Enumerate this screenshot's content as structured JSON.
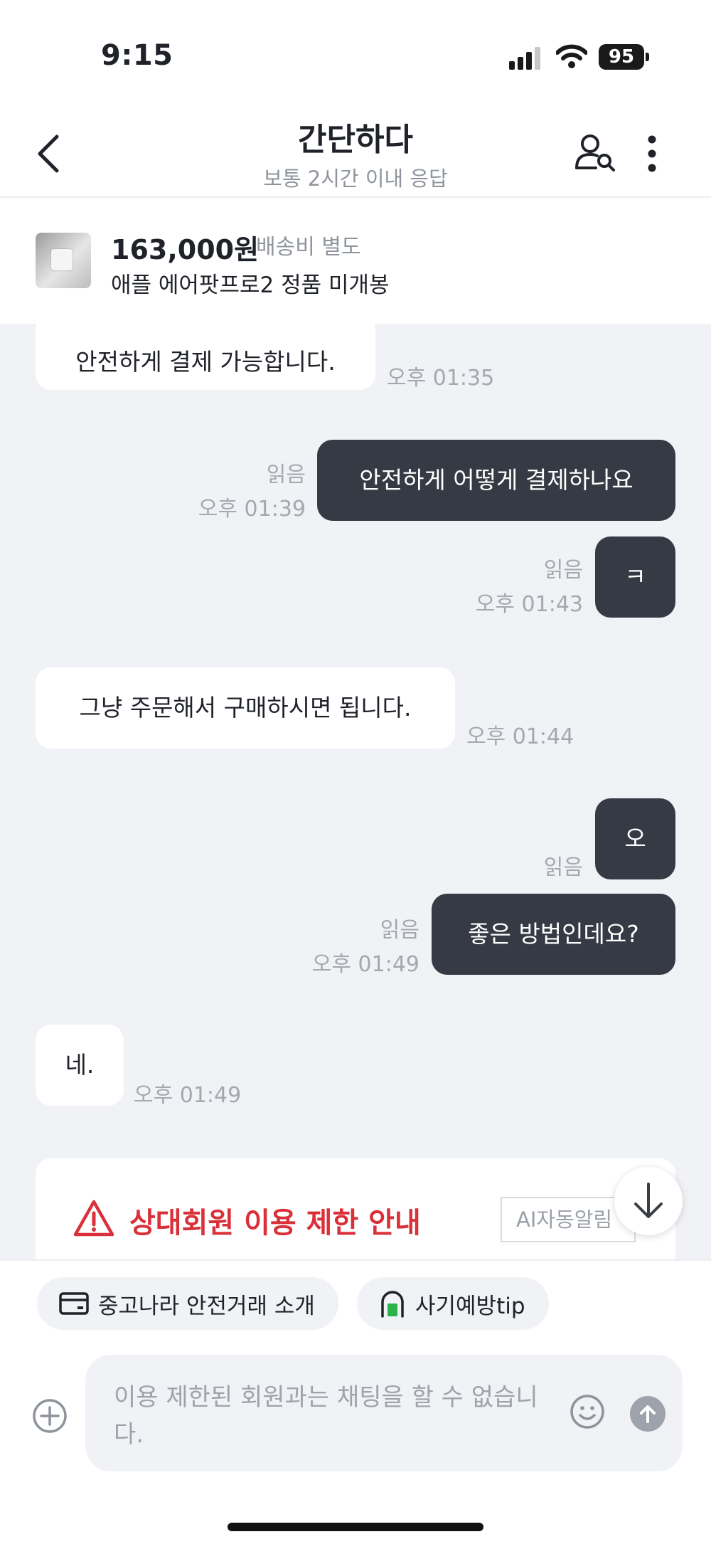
{
  "status_bar": {
    "time": "9:15",
    "battery": "95"
  },
  "header": {
    "title": "간단하다",
    "subtitle": "보통 2시간 이내 응답"
  },
  "product": {
    "price": "163,000원",
    "shipping": "배송비 별도",
    "name": "애플 에어팟프로2 정품 미개봉"
  },
  "messages": [
    {
      "dir": "in",
      "text": "안전하게 결제 가능합니다.",
      "time": "오후 01:35"
    },
    {
      "dir": "out",
      "text": "안전하게 어떻게 결제하나요",
      "read": "읽음",
      "time": "오후 01:39"
    },
    {
      "dir": "out",
      "text": "ㅋ",
      "read": "읽음",
      "time": "오후 01:43"
    },
    {
      "dir": "in",
      "text": "그냥 주문해서 구매하시면 됩니다.",
      "time": "오후 01:44"
    },
    {
      "dir": "out",
      "text": "오",
      "read": "읽음",
      "time": ""
    },
    {
      "dir": "out",
      "text": "좋은 방법인데요?",
      "read": "읽음",
      "time": "오후 01:49"
    },
    {
      "dir": "in",
      "text": "네.",
      "time": "오후 01:49"
    }
  ],
  "notice": {
    "title": "상대회원 이용 제한 안내",
    "badge": "AI자동알림"
  },
  "chips": [
    {
      "label": "중고나라 안전거래 소개",
      "icon": "card-icon"
    },
    {
      "label": "사기예방tip",
      "icon": "lock-door-icon"
    }
  ],
  "composer": {
    "placeholder": "이용 제한된 회원과는 채팅을 할 수 없습니다."
  },
  "colors": {
    "outgoing_bubble": "#353a44",
    "chat_bg": "#f0f2f5",
    "warning": "#d9303a"
  }
}
